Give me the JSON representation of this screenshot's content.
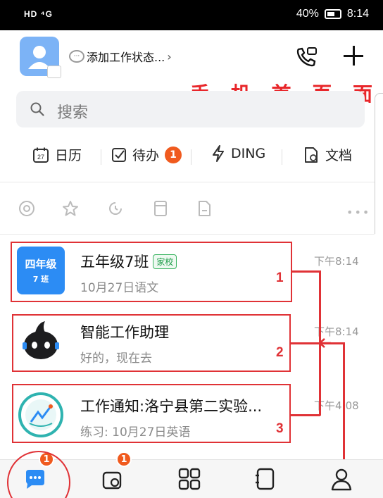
{
  "statusbar": {
    "left": "HD ⁴G",
    "battery": "40%",
    "time": "8:14"
  },
  "header": {
    "status_label": "添加工作状态...",
    "chevron": "›"
  },
  "annotation_title": "手 机 首 页 面",
  "search": {
    "placeholder": "搜索"
  },
  "quick_actions": [
    {
      "label": "日历",
      "icon": "calendar-icon"
    },
    {
      "label": "待办",
      "icon": "todo-icon",
      "badge": "1"
    },
    {
      "label": "DING",
      "icon": "ding-icon"
    },
    {
      "label": "文档",
      "icon": "document-icon"
    }
  ],
  "filter_icons": [
    "at-icon",
    "star-icon",
    "clock-icon",
    "archive-icon",
    "file-icon",
    "more-icon"
  ],
  "chats": [
    {
      "title": "五年级7班",
      "tag": "家校",
      "subtitle": "10月27日语文",
      "time": "下午8:14",
      "avatar_line1": "四年级",
      "avatar_line2": "7 班"
    },
    {
      "title": "智能工作助理",
      "subtitle": "好的，现在去",
      "time": "下午8:14"
    },
    {
      "title": "工作通知:洛宁县第二实验...",
      "subtitle": "练习: 10月27日英语",
      "time": "下午4:08"
    }
  ],
  "annotations": {
    "n1": "1",
    "n2": "2",
    "n3": "3"
  },
  "tabbar": {
    "tabs": [
      {
        "icon": "messages-icon",
        "badge": "1"
      },
      {
        "icon": "docs-icon",
        "badge": "1"
      },
      {
        "icon": "workspace-icon"
      },
      {
        "icon": "contacts-icon"
      },
      {
        "icon": "profile-icon"
      }
    ]
  },
  "colors": {
    "accent": "#2c8cf4",
    "badge": "#f05a1e",
    "annotation": "#e03236",
    "tag_green": "#1f9d4a"
  }
}
